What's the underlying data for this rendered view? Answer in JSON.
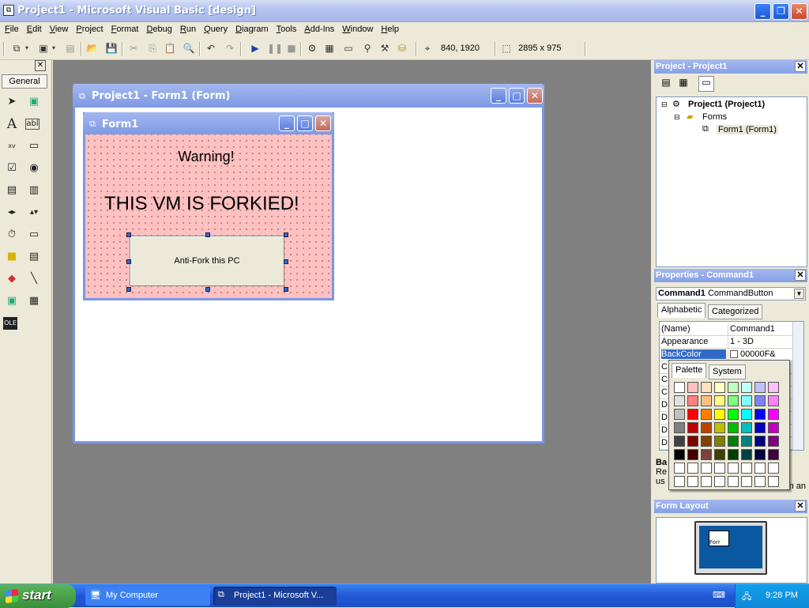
{
  "window": {
    "title": "Project1 - Microsoft Visual Basic [design]"
  },
  "menu": [
    "File",
    "Edit",
    "View",
    "Project",
    "Format",
    "Debug",
    "Run",
    "Query",
    "Diagram",
    "Tools",
    "Add-Ins",
    "Window",
    "Help"
  ],
  "toolbar": {
    "position": "840, 1920",
    "size": "2895 x 975"
  },
  "toolbox": {
    "tab": "General"
  },
  "designer": {
    "title": "Project1 - Form1 (Form)",
    "form": {
      "title": "Form1",
      "label1": "Warning!",
      "label2": "THIS VM IS FORKIED!",
      "button": "Anti-Fork this PC",
      "backcolor": "#ffc0c0"
    }
  },
  "project": {
    "title": "Project - Project1",
    "root": "Project1 (Project1)",
    "folder": "Forms",
    "item": "Form1 (Form1)"
  },
  "properties": {
    "title": "Properties - Command1",
    "object": "Command1",
    "object_type": "CommandButton",
    "tabs": [
      "Alphabetic",
      "Categorized"
    ],
    "rows": [
      {
        "k": "(Name)",
        "v": "Command1"
      },
      {
        "k": "Appearance",
        "v": "1 - 3D"
      },
      {
        "k": "BackColor",
        "v": "00000F&"
      }
    ],
    "hidden_rows": [
      "C",
      "C",
      "C",
      "D",
      "D",
      "D",
      "D"
    ],
    "desc_title": "Ba",
    "desc_lines": [
      "Re",
      "us"
    ],
    "desc_tail": "n an"
  },
  "palette": {
    "tabs": [
      "Palette",
      "System"
    ],
    "colors": [
      "#ffffff",
      "#ffc0c0",
      "#ffe0c0",
      "#ffffc0",
      "#c0ffc0",
      "#c0ffff",
      "#c0c0ff",
      "#ffc0ff",
      "#e0e0e0",
      "#ff8080",
      "#ffc080",
      "#ffff80",
      "#80ff80",
      "#80ffff",
      "#8080ff",
      "#ff80ff",
      "#c0c0c0",
      "#ff0000",
      "#ff8000",
      "#ffff00",
      "#00ff00",
      "#00ffff",
      "#0000ff",
      "#ff00ff",
      "#808080",
      "#c00000",
      "#c04000",
      "#c0c000",
      "#00c000",
      "#00c0c0",
      "#0000c0",
      "#c000c0",
      "#404040",
      "#800000",
      "#804000",
      "#808000",
      "#008000",
      "#008080",
      "#000080",
      "#800080",
      "#000000",
      "#400000",
      "#804040",
      "#404000",
      "#004000",
      "#004040",
      "#000040",
      "#400040",
      "#ffffff",
      "#ffffff",
      "#ffffff",
      "#ffffff",
      "#ffffff",
      "#ffffff",
      "#ffffff",
      "#ffffff",
      "#ffffff",
      "#ffffff",
      "#ffffff",
      "#ffffff",
      "#ffffff",
      "#ffffff",
      "#ffffff",
      "#ffffff"
    ]
  },
  "layout": {
    "title": "Form Layout",
    "mini": "Forr"
  },
  "taskbar": {
    "start": "start",
    "tasks": [
      "My Computer",
      "Project1 - Microsoft V..."
    ],
    "clock": "9:28 PM"
  }
}
